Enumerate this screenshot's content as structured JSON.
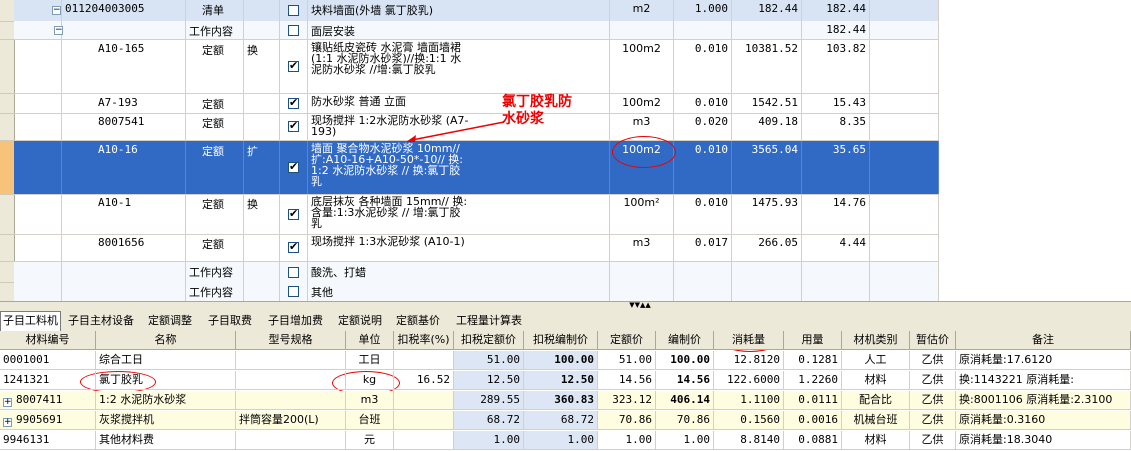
{
  "upper": {
    "rows": [
      {
        "code": "011204003005",
        "type": "清单",
        "flag": "",
        "checked": false,
        "name": "块料墙面(外墙 氯丁胶乳)",
        "unit": "m2",
        "qty": "1.000",
        "price": "182.44",
        "total": "182.44"
      },
      {
        "code": "",
        "type": "工作内容",
        "flag": "",
        "checked": false,
        "name": "面层安装",
        "unit": "",
        "qty": "",
        "price": "",
        "total": "182.44"
      },
      {
        "code": "A10-165",
        "type": "定额",
        "flag": "换",
        "checked": true,
        "name": "镶贴纸皮瓷砖 水泥膏 墙面墙裙(1:1 水泥防水砂浆)//换:1:1 水泥防水砂浆 //增:氯丁胶乳",
        "unit": "100m2",
        "qty": "0.010",
        "price": "10381.52",
        "total": "103.82"
      },
      {
        "code": "A7-193",
        "type": "定额",
        "flag": "",
        "checked": true,
        "name": "防水砂浆 普通 立面",
        "unit": "100m2",
        "qty": "0.010",
        "price": "1542.51",
        "total": "15.43"
      },
      {
        "code": "8007541",
        "type": "定额",
        "flag": "",
        "checked": true,
        "name": "现场搅拌 1:2水泥防水砂浆 (A7-193)",
        "unit": "m3",
        "qty": "0.020",
        "price": "409.18",
        "total": "8.35"
      },
      {
        "code": "A10-16",
        "type": "定额",
        "flag": "扩",
        "checked": true,
        "name": "墙面 聚合物水泥砂浆 10mm// 扩:A10-16+A10-50*-10// 换:1:2 水泥防水砂浆 // 换:氯丁胶乳",
        "unit": "100m2",
        "qty": "0.010",
        "price": "3565.04",
        "total": "35.65"
      },
      {
        "code": "A10-1",
        "type": "定额",
        "flag": "换",
        "checked": true,
        "name": "底层抹灰 各种墙面 15mm// 换:含量:1:3水泥砂浆 // 增:氯丁胶乳",
        "unit": "100m²",
        "qty": "0.010",
        "price": "1475.93",
        "total": "14.76"
      },
      {
        "code": "8001656",
        "type": "定额",
        "flag": "",
        "checked": true,
        "name": "现场搅拌 1:3水泥砂浆 (A10-1)",
        "unit": "m3",
        "qty": "0.017",
        "price": "266.05",
        "total": "4.44"
      },
      {
        "code": "",
        "type": "工作内容",
        "flag": "",
        "checked": false,
        "name": "酸洗、打蜡",
        "unit": "",
        "qty": "",
        "price": "",
        "total": ""
      },
      {
        "code": "",
        "type": "工作内容",
        "flag": "",
        "checked": false,
        "name": "其他",
        "unit": "",
        "qty": "",
        "price": "",
        "total": ""
      }
    ]
  },
  "annotation": {
    "line1": "氯丁胶乳防",
    "line2": "水砂浆"
  },
  "tabs": [
    "子目工料机",
    "子目主材设备",
    "定额调整",
    "子目取费",
    "子目增加费",
    "定额说明",
    "定额基价",
    "工程量计算表"
  ],
  "lower": {
    "headers": [
      "材料编号",
      "名称",
      "型号规格",
      "单位",
      "扣税率(%)",
      "扣税定额价",
      "扣税编制价",
      "定额价",
      "编制价",
      "消耗量",
      "用量",
      "材机类别",
      "暂估价",
      "备注"
    ],
    "rows": [
      {
        "expand": false,
        "code": "0001001",
        "name": "综合工日",
        "spec": "",
        "unit": "工日",
        "tax": "",
        "tdp": "51.00",
        "tbp": "100.00",
        "dp": "51.00",
        "bp": "100.00",
        "cons": "12.8120",
        "use": "0.1281",
        "cat": "人工",
        "est": "乙供",
        "note": "原消耗量:17.6120"
      },
      {
        "expand": false,
        "code": "1241321",
        "name": "氯丁胶乳",
        "spec": "",
        "unit": "kg",
        "tax": "16.52",
        "tdp": "12.50",
        "tbp": "12.50",
        "dp": "14.56",
        "bp": "14.56",
        "cons": "122.6000",
        "use": "1.2260",
        "cat": "材料",
        "est": "乙供",
        "note": "换:1143221 原消耗量:"
      },
      {
        "expand": true,
        "code": "8007411",
        "name": "1:2 水泥防水砂浆",
        "spec": "",
        "unit": "m3",
        "tax": "",
        "tdp": "289.55",
        "tbp": "360.83",
        "dp": "323.12",
        "bp": "406.14",
        "cons": "1.1100",
        "use": "0.0111",
        "cat": "配合比",
        "est": "乙供",
        "note": "换:8001106 原消耗量:2.3100"
      },
      {
        "expand": true,
        "code": "9905691",
        "name": "灰浆搅拌机",
        "spec": "拌筒容量200(L)",
        "unit": "台班",
        "tax": "",
        "tdp": "68.72",
        "tbp": "68.72",
        "dp": "70.86",
        "bp": "70.86",
        "cons": "0.1560",
        "use": "0.0016",
        "cat": "机械台班",
        "est": "乙供",
        "note": "原消耗量:0.3160"
      },
      {
        "expand": false,
        "code": "9946131",
        "name": "其他材料费",
        "spec": "",
        "unit": "元",
        "tax": "",
        "tdp": "1.00",
        "tbp": "1.00",
        "dp": "1.00",
        "bp": "1.00",
        "cons": "8.8140",
        "use": "0.0881",
        "cat": "材料",
        "est": "乙供",
        "note": "原消耗量:18.3040"
      }
    ]
  }
}
